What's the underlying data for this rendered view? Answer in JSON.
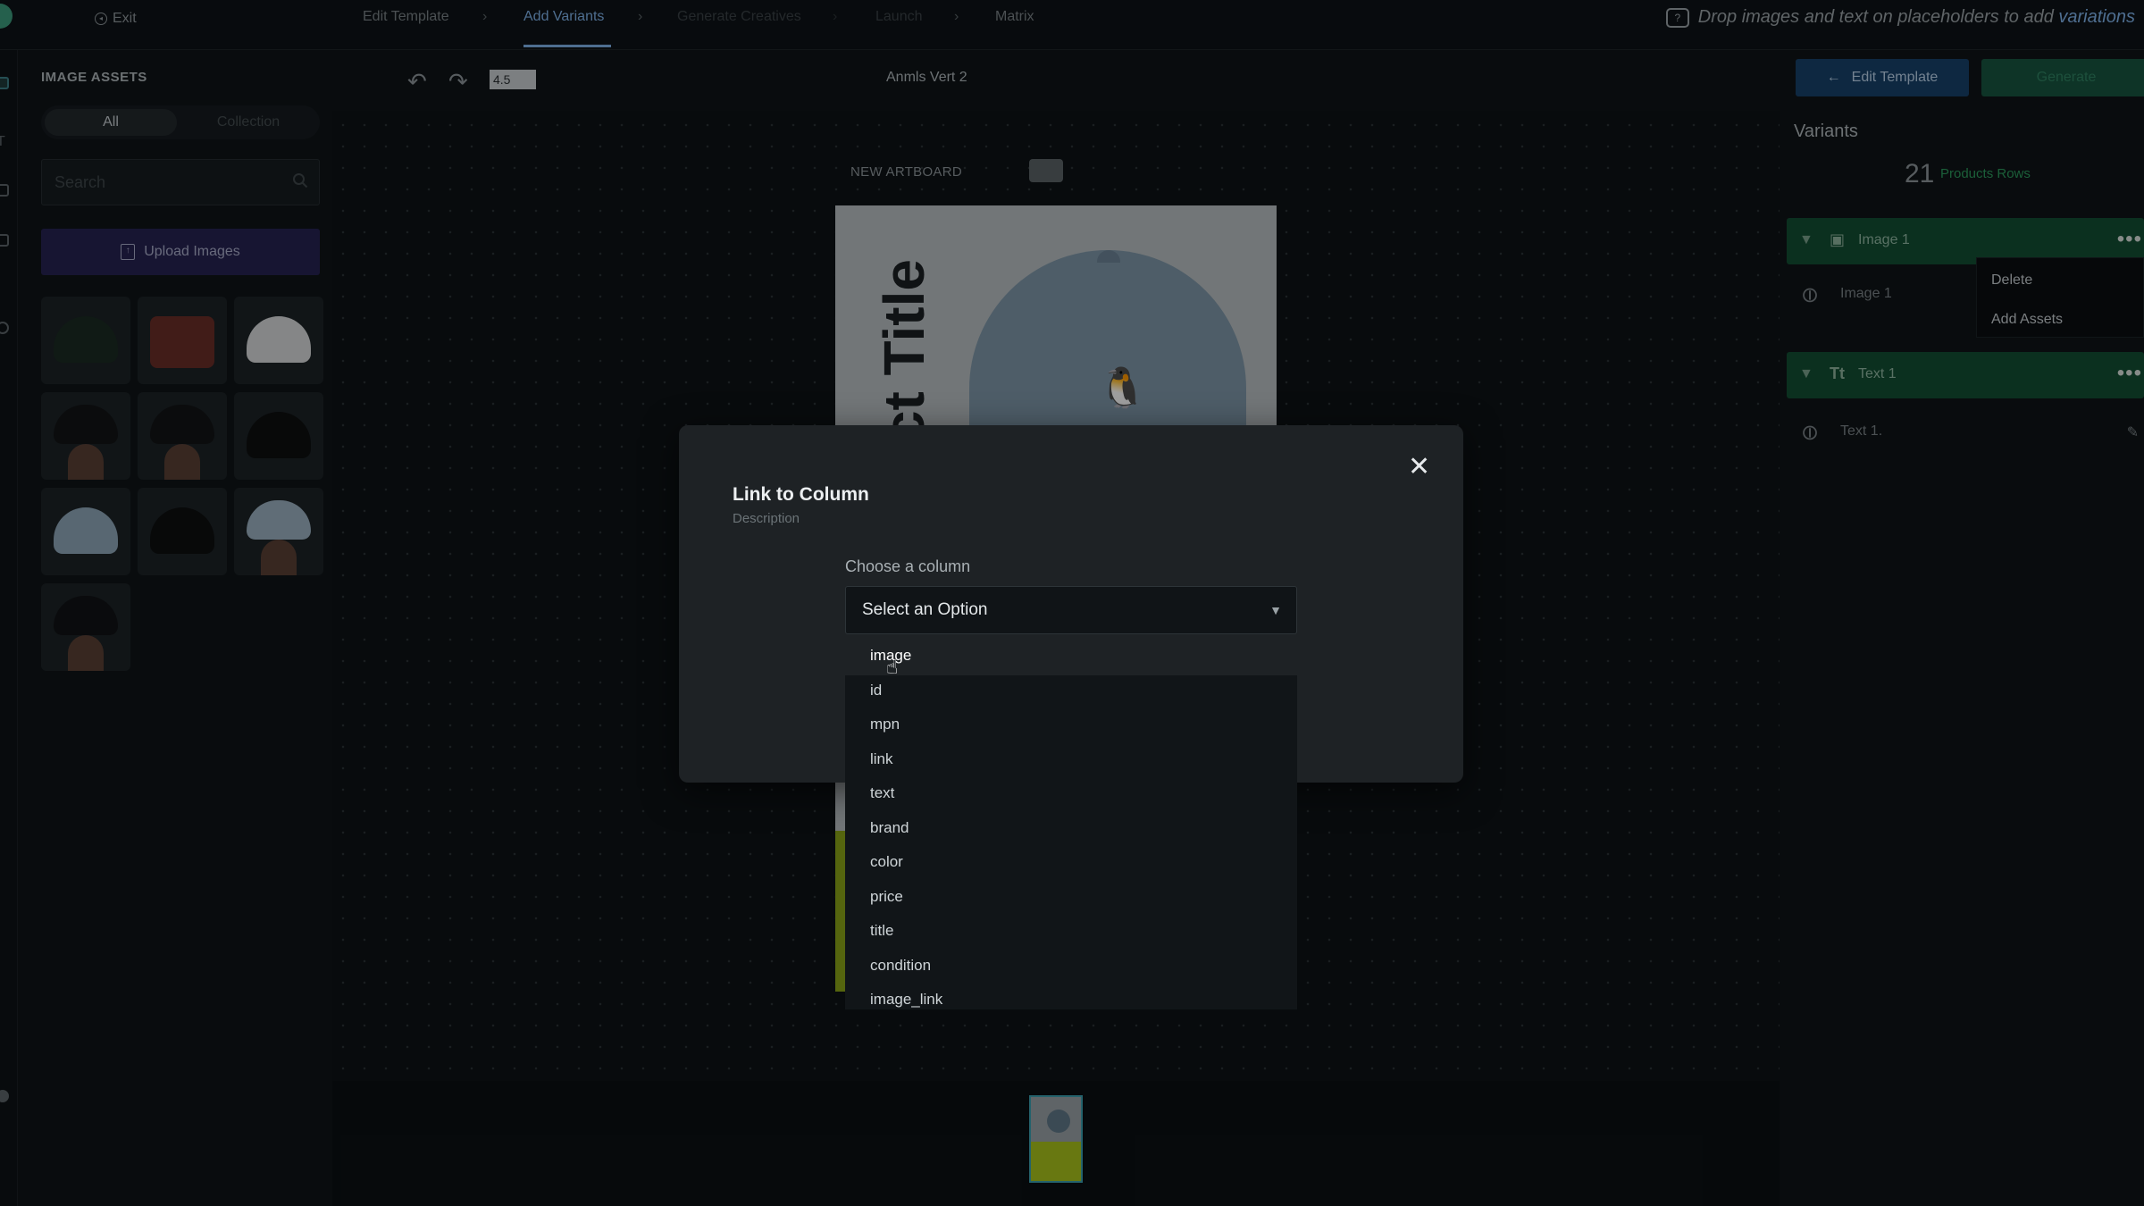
{
  "topbar": {
    "exit_label": "Exit",
    "steps": [
      "Edit Template",
      "Add Variants",
      "Generate Creatives",
      "Launch",
      "Matrix"
    ],
    "active_step": "Add Variants",
    "hint_text": "Drop images and text on placeholders to add",
    "hint_accent": "variations"
  },
  "assets": {
    "title": "IMAGE ASSETS",
    "tabs": [
      "All",
      "Collection"
    ],
    "search_placeholder": "Search",
    "upload_label": "Upload Images",
    "thumbnails": [
      {
        "type": "cap",
        "color": "#1a2a22"
      },
      {
        "type": "chair",
        "color": "#6a2e28"
      },
      {
        "type": "cap",
        "color": "#d7d9da"
      },
      {
        "type": "cap-face",
        "color": "#121416"
      },
      {
        "type": "cap-face",
        "color": "#121416"
      },
      {
        "type": "cap",
        "color": "#0d0f10"
      },
      {
        "type": "cap",
        "color": "#8ea6b8"
      },
      {
        "type": "cap",
        "color": "#0d0f10"
      },
      {
        "type": "cap-face",
        "color": "#9bb1c0"
      },
      {
        "type": "cap-face",
        "color": "#111315"
      }
    ]
  },
  "canvas": {
    "zoom": "4.5",
    "doc_title": "Anmls Vert 2",
    "artboard_label": "NEW ARTBOARD",
    "product_title_text": "Product Title"
  },
  "variants": {
    "edit_template_label": "Edit Template",
    "generate_label": "Generate",
    "title": "Variants",
    "count": "21",
    "rows_label": "Products Rows",
    "groups": [
      {
        "label": "Image 1",
        "link_label": "Image 1"
      },
      {
        "label": "Text 1",
        "link_label": "Text 1."
      }
    ],
    "context_menu": [
      "Delete",
      "Add Assets"
    ]
  },
  "modal": {
    "title": "Link to Column",
    "description": "Description",
    "choose_label": "Choose a column",
    "select_value": "Select an Option",
    "options": [
      "image",
      "id",
      "mpn",
      "link",
      "text",
      "brand",
      "color",
      "price",
      "title",
      "condition",
      "image_link"
    ]
  }
}
